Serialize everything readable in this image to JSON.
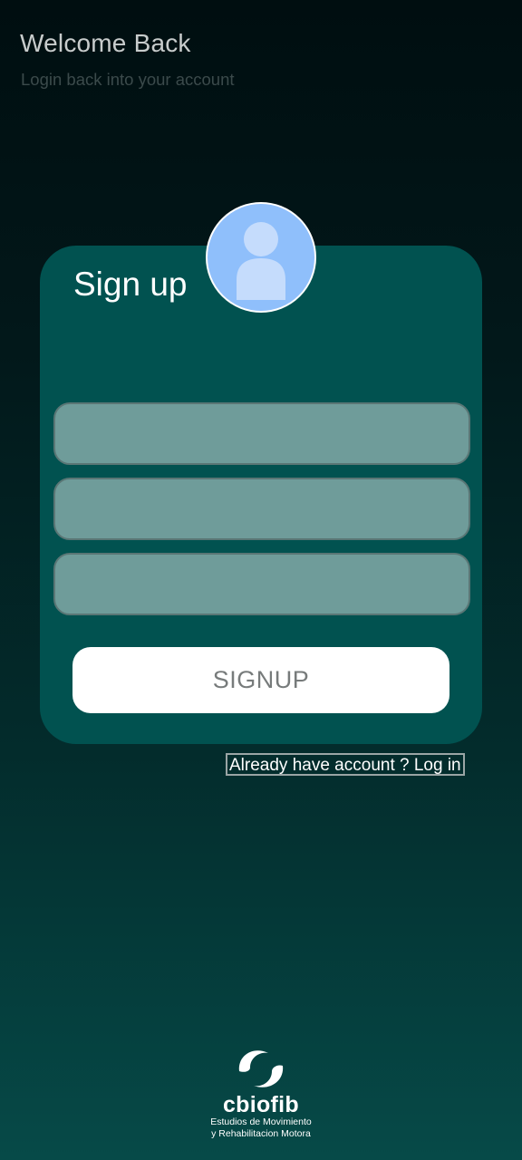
{
  "header": {
    "title": "Welcome Back",
    "subtitle": "Login back into your account"
  },
  "card": {
    "title": "Sign up",
    "avatar_icon": "user-avatar-icon",
    "fields": [
      {
        "value": "",
        "placeholder": ""
      },
      {
        "value": "",
        "placeholder": ""
      },
      {
        "value": "",
        "placeholder": ""
      }
    ],
    "signup_label": "SIGNUP"
  },
  "login_link": "Already have account ? Log in",
  "logo": {
    "icon": "cbiofib-logo-icon",
    "name": "cbiofib",
    "tagline_line1": "Estudios de Movimiento",
    "tagline_line2": "y Rehabilitacion Motora"
  },
  "colors": {
    "card_background": "#015250",
    "field_background": "#6f9c9a",
    "avatar_background": "#8fbffb",
    "button_background": "#ffffff"
  }
}
